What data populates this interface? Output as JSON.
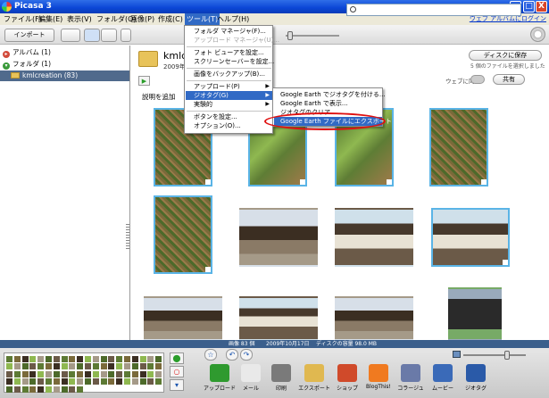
{
  "window": {
    "title": "Picasa 3",
    "min_glyph": "_",
    "max_glyph": "□",
    "close_glyph": "X"
  },
  "menubar": {
    "items": [
      "ファイル(F)",
      "編集(E)",
      "表示(V)",
      "フォルダ(O)",
      "画像(P)",
      "作成(C)",
      "ツール(T)",
      "ヘルプ(H)"
    ],
    "web_link": "ウェブ アルバムにログイン"
  },
  "toolbar": {
    "import_label": "インポート",
    "search_placeholder": ""
  },
  "sidebar": {
    "rows": [
      {
        "label": "アルバム (1)",
        "toggle": "▸"
      },
      {
        "label": "フォルダ (1)",
        "toggle": "▾"
      },
      {
        "label": "kmlcreation (83)"
      }
    ]
  },
  "main": {
    "folder_title": "kmlcre",
    "folder_date": "2009年10",
    "disk_save": "ディスクに保存",
    "sel_count": "5 個のファイルを選択しました",
    "web_sync": "ウェブに同期",
    "share": "共有",
    "caption_add": "説明を追加",
    "play_glyph": "▶"
  },
  "tools_menu": {
    "items": [
      {
        "label": "フォルダ マネージャ(F)...",
        "disabled": false,
        "arrow": ""
      },
      {
        "label": "アップロード マネージャ(U)...",
        "disabled": true,
        "arrow": ""
      },
      {
        "label": "フォト ビューアを設定...",
        "disabled": false,
        "arrow": ""
      },
      {
        "label": "スクリーンセーバーを設定...",
        "disabled": false,
        "arrow": ""
      },
      {
        "label": "画像をバックアップ(B)...",
        "disabled": false,
        "arrow": ""
      },
      {
        "label": "アップロード(P)",
        "disabled": false,
        "arrow": "▶"
      },
      {
        "label": "ジオタグ(G)",
        "disabled": false,
        "arrow": "▶"
      },
      {
        "label": "実験的",
        "disabled": false,
        "arrow": "▶"
      },
      {
        "label": "ボタンを設定...",
        "disabled": false,
        "arrow": ""
      },
      {
        "label": "オプション(O)...",
        "disabled": false,
        "arrow": ""
      }
    ]
  },
  "geo_menu": {
    "items": [
      {
        "label": "Google Earth でジオタグを付ける..."
      },
      {
        "label": "Google Earth で表示..."
      },
      {
        "label": "ジオタグのクリア"
      },
      {
        "label": "Google Earth ファイルにエクスポート"
      }
    ]
  },
  "statusbar": {
    "count": "画像 83 個",
    "date": "2009年10月17日",
    "disk": "ディスクの容量 98.0 MB"
  },
  "tray": {
    "actions": [
      {
        "label": "アップロード",
        "color": "#2f9a2f"
      },
      {
        "label": "メール",
        "color": "#e9e9e9"
      },
      {
        "label": "印刷",
        "color": "#7a7a7a"
      },
      {
        "label": "エクスポート",
        "color": "#e0b850"
      },
      {
        "label": "ショップ",
        "color": "#d04a2a"
      },
      {
        "label": "BlogThis!",
        "color": "#f07a20"
      },
      {
        "label": "コラージュ",
        "color": "#6a7aa8"
      },
      {
        "label": "ムービー",
        "color": "#3a6ab8"
      },
      {
        "label": "ジオタグ",
        "color": "#2a5aa8"
      }
    ],
    "star_glyph": "☆",
    "rotate_left_glyph": "↶",
    "rotate_right_glyph": "↷"
  }
}
